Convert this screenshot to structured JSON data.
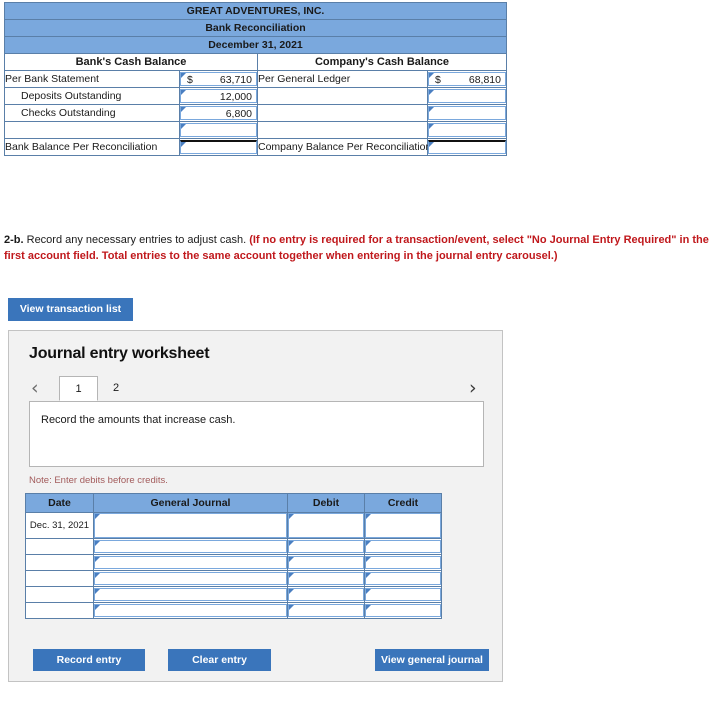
{
  "reconciliation": {
    "company_name": "GREAT ADVENTURES, INC.",
    "statement_title": "Bank Reconciliation",
    "statement_date": "December 31, 2021",
    "left_section_header": "Bank's Cash Balance",
    "right_section_header": "Company's Cash Balance",
    "rows": [
      {
        "left_label": "Per Bank Statement",
        "left_dollar": "$",
        "left_amount": "63,710",
        "right_label": "Per General Ledger",
        "right_dollar": "$",
        "right_amount": "68,810"
      },
      {
        "left_label": "Deposits Outstanding",
        "left_dollar": "",
        "left_amount": "12,000",
        "right_label": "",
        "right_dollar": "",
        "right_amount": ""
      },
      {
        "left_label": "Checks Outstanding",
        "left_dollar": "",
        "left_amount": "6,800",
        "right_label": "",
        "right_dollar": "",
        "right_amount": ""
      },
      {
        "left_label": "",
        "left_dollar": "",
        "left_amount": "",
        "right_label": "",
        "right_dollar": "",
        "right_amount": ""
      }
    ],
    "total_row": {
      "left_label": "Bank Balance Per Reconciliation",
      "left_amount": "",
      "right_label": "Company Balance Per Reconciliation",
      "right_amount": ""
    }
  },
  "instruction": {
    "number": "2-b.",
    "text": " Record any necessary entries to adjust cash. ",
    "red_text": "(If no entry is required for a transaction/event, select \"No Journal Entry Required\" in the first account field. Total entries to the same account together when entering in the journal entry carousel.)"
  },
  "toolbar": {
    "view_transaction_list": "View transaction list"
  },
  "worksheet": {
    "title": "Journal entry worksheet",
    "tabs": [
      {
        "label": "1",
        "active": true
      },
      {
        "label": "2",
        "active": false
      }
    ],
    "prev_arrow": "‹",
    "next_arrow": "›",
    "prompt": "Record the amounts that increase cash.",
    "note": "Note: Enter debits before credits.",
    "table": {
      "headers": [
        "Date",
        "General Journal",
        "Debit",
        "Credit"
      ],
      "rows": [
        {
          "date": "Dec. 31,\n2021",
          "journal": "",
          "debit": "",
          "credit": ""
        },
        {
          "date": "",
          "journal": "",
          "debit": "",
          "credit": ""
        },
        {
          "date": "",
          "journal": "",
          "debit": "",
          "credit": ""
        },
        {
          "date": "",
          "journal": "",
          "debit": "",
          "credit": ""
        },
        {
          "date": "",
          "journal": "",
          "debit": "",
          "credit": ""
        },
        {
          "date": "",
          "journal": "",
          "debit": "",
          "credit": ""
        }
      ]
    },
    "buttons": {
      "record_entry": "Record entry",
      "clear_entry": "Clear entry",
      "view_general_journal": "View general journal"
    }
  },
  "colors": {
    "header_blue": "#7aa8dd",
    "button_blue": "#3a75bb",
    "red_text": "#c0181c",
    "note_red": "#a35c5c",
    "panel_gray": "#f2f2f2",
    "cell_border": "#5a7fa8"
  }
}
